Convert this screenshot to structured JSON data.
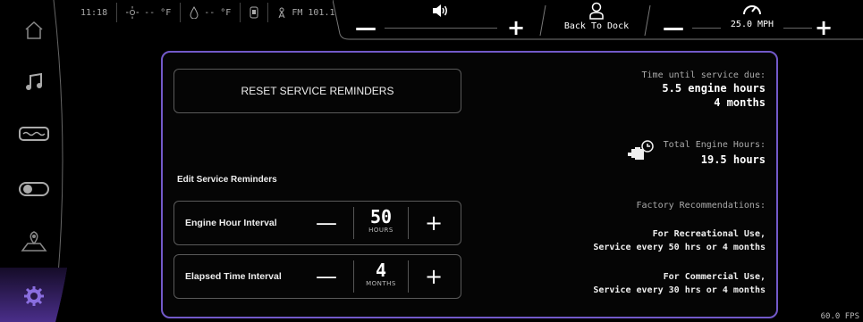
{
  "status": {
    "time": "11:18",
    "temp_air": "-- °F",
    "temp_water": "-- °F",
    "radio": "FM 101.1"
  },
  "topbar": {
    "minus": "—",
    "plus": "+",
    "dock_label": "Back To Dock",
    "speed": "25.0 MPH"
  },
  "panel": {
    "reset_label": "RESET SERVICE REMINDERS",
    "edit_title": "Edit Service Reminders",
    "intervals": [
      {
        "label": "Engine Hour Interval",
        "value": "50",
        "unit": "HOURS"
      },
      {
        "label": "Elapsed Time Interval",
        "value": "4",
        "unit": "MONTHS"
      }
    ],
    "minus": "—",
    "plus": "+",
    "service_due_label": "Time until service due:",
    "service_due_hours": "5.5 engine hours",
    "service_due_months": "4 months",
    "engine_hours_label": "Total Engine Hours:",
    "engine_hours_value": "19.5 hours",
    "factory_label": "Factory Recommendations:",
    "rec_title": "For Recreational Use,",
    "rec_detail": "Service every 50 hrs or 4 months",
    "com_title": "For Commercial Use,",
    "com_detail": "Service every 30 hrs or 4 months"
  },
  "fps": "60.0 FPS",
  "colors": {
    "accent": "#7259c9",
    "active_icon": "#8a6ee0"
  },
  "sidebar": [
    "home-icon",
    "music-icon",
    "boat-icon",
    "toggle-icon",
    "map-icon",
    "gear-icon"
  ]
}
